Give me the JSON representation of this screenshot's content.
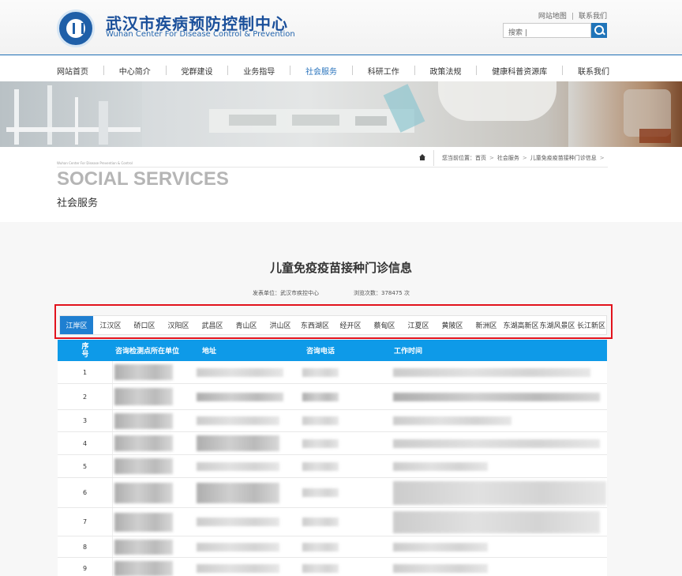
{
  "header": {
    "site_name_cn": "武汉市疾病预防控制中心",
    "site_name_en": "Wuhan Center For Disease Control & Prevention",
    "top_links": [
      "网站地图",
      "联系我们"
    ],
    "search_placeholder": "搜索 |"
  },
  "nav": {
    "items": [
      "网站首页",
      "中心简介",
      "党群建设",
      "业务指导",
      "社会服务",
      "科研工作",
      "政策法规",
      "健康科普资源库",
      "联系我们"
    ],
    "active": "社会服务"
  },
  "breadcrumb": {
    "prefix": "您当前位置：",
    "items": [
      "首页",
      "社会服务",
      "儿童免疫疫苗接种门诊信息"
    ]
  },
  "section": {
    "small_text": "Wuhan Center For Disease Prevention & Control",
    "title_en": "SOCIAL SERVICES",
    "title_cn": "社会服务"
  },
  "article": {
    "title": "儿童免疫疫苗接种门诊信息",
    "publisher": "发表单位：武汉市疾控中心",
    "views": "浏览次数：378475 次"
  },
  "district_tabs": {
    "active": "江岸区",
    "items": [
      "江岸区",
      "江汉区",
      "硚口区",
      "汉阳区",
      "武昌区",
      "青山区",
      "洪山区",
      "东西湖区",
      "经开区",
      "蔡甸区",
      "江夏区",
      "黄陂区",
      "新洲区",
      "东湖高新区",
      "东湖风景区",
      "长江新区"
    ]
  },
  "table": {
    "headers": [
      "序号",
      "咨询检测点所在单位",
      "地址",
      "咨询电话",
      "工作时间"
    ],
    "row_numbers": [
      "1",
      "2",
      "3",
      "4",
      "5",
      "6",
      "7",
      "8",
      "9"
    ]
  },
  "colors": {
    "brand_blue": "#1a4f9a",
    "nav_active": "#2a74bd",
    "tab_active": "#1f7fd1",
    "table_header": "#0e9ae8",
    "highlight_box": "#e2131d"
  }
}
